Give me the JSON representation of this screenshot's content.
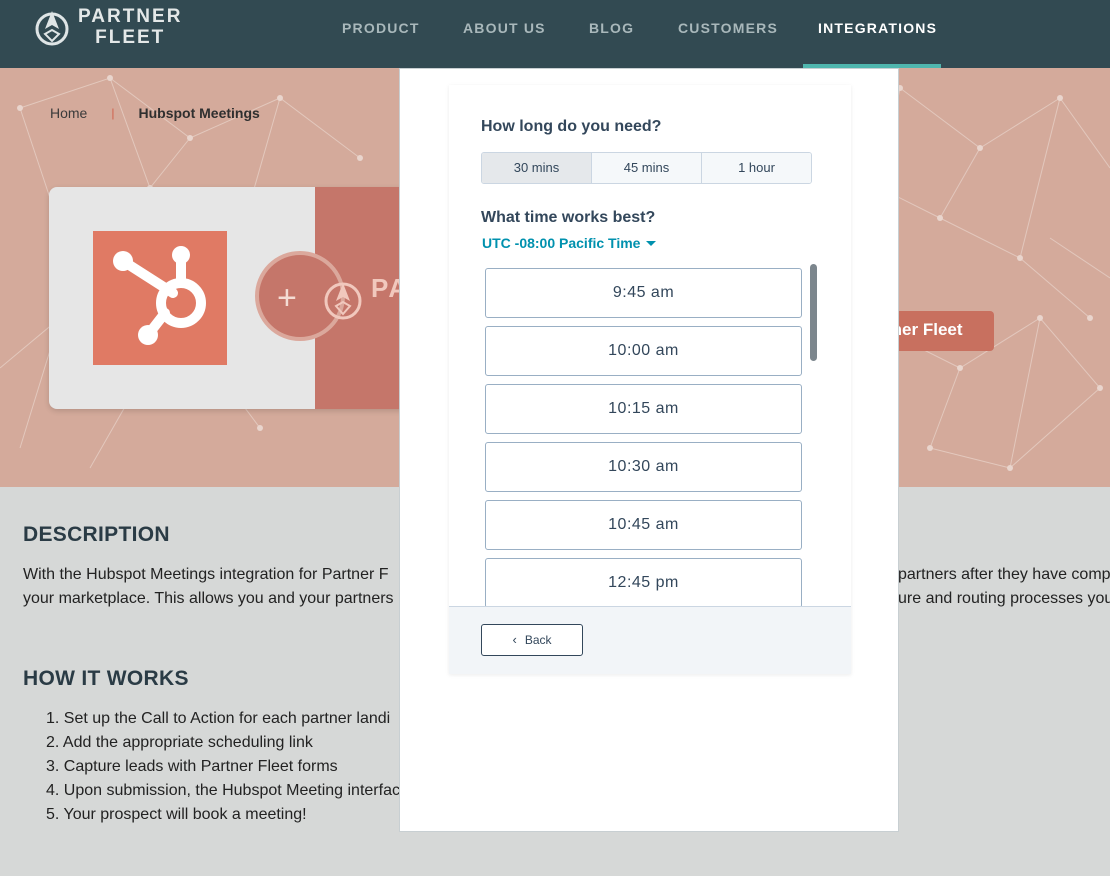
{
  "brand": {
    "line1": "PARTNER",
    "line2": "FLEET"
  },
  "nav": {
    "items": [
      {
        "label": "PRODUCT"
      },
      {
        "label": "ABOUT US"
      },
      {
        "label": "BLOG"
      },
      {
        "label": "CUSTOMERS"
      },
      {
        "label": "INTEGRATIONS",
        "active": true
      }
    ]
  },
  "breadcrumb": {
    "home": "Home",
    "separator": "|",
    "current": "Hubspot Meetings"
  },
  "hero": {
    "plus": "+",
    "partial_logo_letter": "PA",
    "cta_partial": "tner Fleet",
    "bg_color": "#d4aa9b",
    "accent": "#c8705f"
  },
  "description": {
    "heading": "DESCRIPTION",
    "line1_left": "With the Hubspot Meetings integration for Partner F",
    "line1_right": "partners after they have comp",
    "line2_left": "your marketplace. This allows you and your partners",
    "line2_right": "ure and routing processes you"
  },
  "how_it_works": {
    "heading": "HOW IT WORKS",
    "steps": [
      "1. Set up the Call to Action for each partner landi",
      "2. Add the appropriate scheduling link",
      "3. Capture leads with Partner Fleet forms",
      "4. Upon submission, the Hubspot Meeting interfac",
      "5. Your prospect will book a meeting!"
    ]
  },
  "scheduler": {
    "duration_question": "How long do you need?",
    "durations": [
      {
        "label": "30 mins",
        "selected": true
      },
      {
        "label": "45 mins",
        "selected": false
      },
      {
        "label": "1 hour",
        "selected": false
      }
    ],
    "time_question": "What time works best?",
    "timezone": "UTC -08:00 Pacific Time",
    "slots": [
      "9:45 am",
      "10:00 am",
      "10:15 am",
      "10:30 am",
      "10:45 am",
      "12:45 pm"
    ],
    "back_label": "Back"
  },
  "colors": {
    "nav_bg": "#324a52",
    "nav_underline": "#4fb6ae",
    "link_teal": "#0091ae",
    "hubspot_orange": "#e07a64"
  }
}
